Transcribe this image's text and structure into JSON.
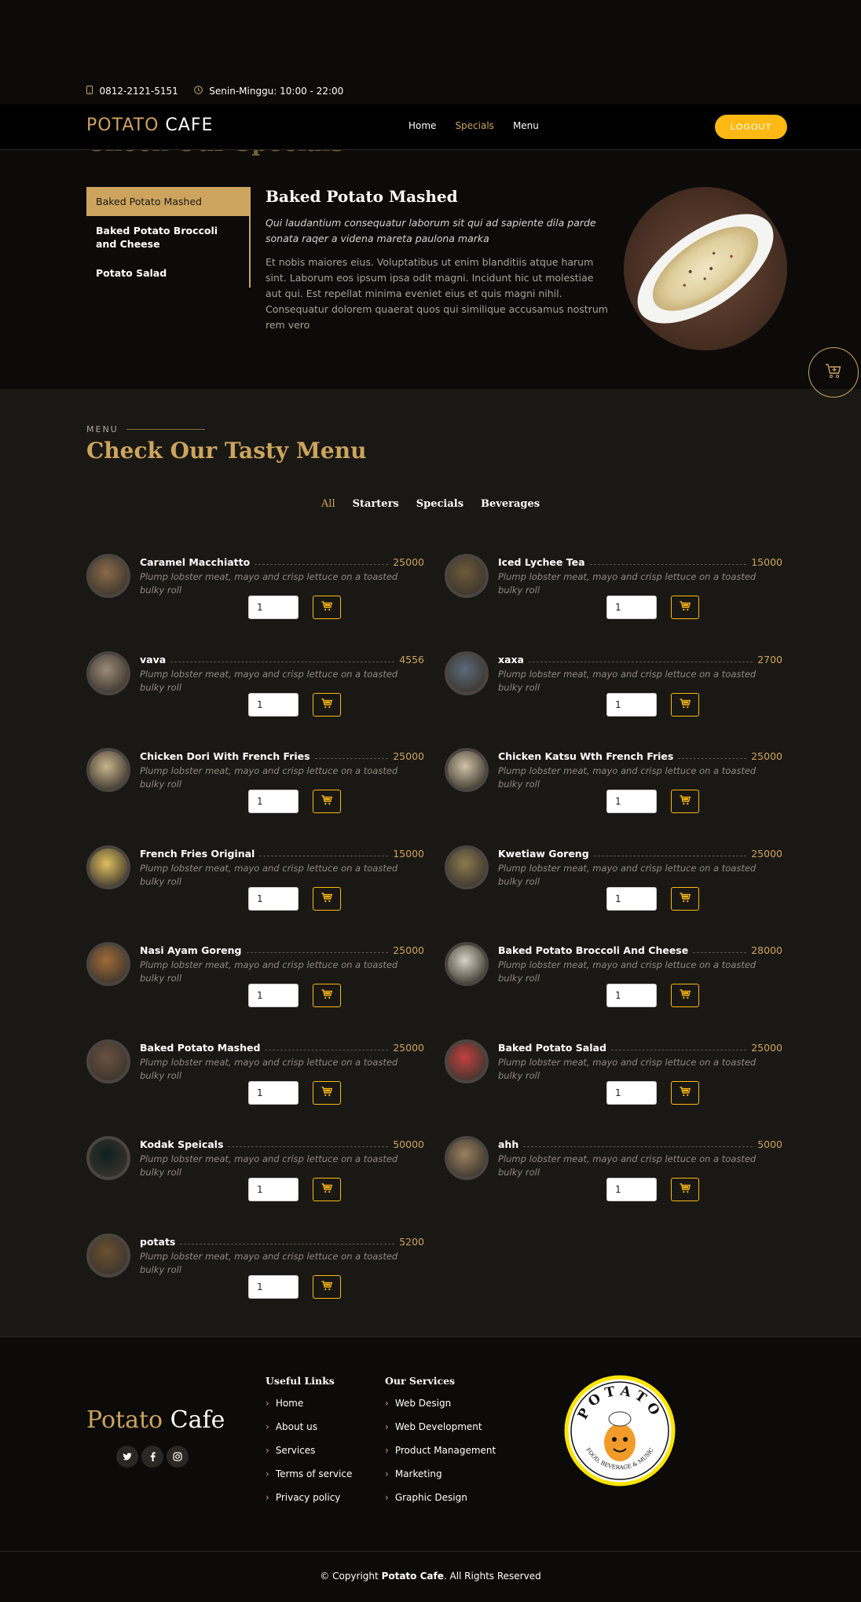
{
  "topbar": {
    "phone": "0812-2121-5151",
    "hours": "Senin-Minggu: 10:00 - 22:00"
  },
  "header": {
    "logo_a": "POTATO",
    "logo_b": "CAFE",
    "nav": [
      "Home",
      "Specials",
      "Menu"
    ],
    "active_nav": "Specials",
    "logout_label": "LOGOUT"
  },
  "specials": {
    "title": "Check Our Specials",
    "tabs": [
      "Baked Potato Mashed",
      "Baked Potato Broccoli and Cheese",
      "Potato Salad"
    ],
    "active_tab": 0,
    "heading": "Baked Potato Mashed",
    "lead": "Qui laudantium consequatur laborum sit qui ad sapiente dila parde sonata raqer a videna mareta paulona marka",
    "description": "Et nobis maiores eius. Voluptatibus ut enim blanditiis atque harum sint. Laborum eos ipsum ipsa odit magni. Incidunt hic ut molestiae aut qui. Est repellat minima eveniet eius et quis magni nihil. Consequatur dolorem quaerat quos qui similique accusamus nostrum rem vero"
  },
  "menu": {
    "eyebrow": "MENU",
    "title": "Check Our Tasty Menu",
    "filters": [
      "All",
      "Starters",
      "Specials",
      "Beverages"
    ],
    "active_filter": "All",
    "ingredients": "Plump lobster meat, mayo and crisp lettuce on a toasted bulky roll",
    "default_qty": "1",
    "items": [
      {
        "name": "Caramel Macchiatto",
        "price": "25000",
        "thumb": "#8a6a4a"
      },
      {
        "name": "Iced Lychee Tea",
        "price": "15000",
        "thumb": "#6b5a3a"
      },
      {
        "name": "vava",
        "price": "4556",
        "thumb": "#9a8a7a"
      },
      {
        "name": "xaxa",
        "price": "2700",
        "thumb": "#5a6a7a"
      },
      {
        "name": "Chicken Dori With French Fries",
        "price": "25000",
        "thumb": "#c9b58a"
      },
      {
        "name": "Chicken Katsu Wth French Fries",
        "price": "25000",
        "thumb": "#d0c4a8"
      },
      {
        "name": "French Fries Original",
        "price": "15000",
        "thumb": "#e0c060"
      },
      {
        "name": "Kwetiaw Goreng",
        "price": "25000",
        "thumb": "#8a7a50"
      },
      {
        "name": "Nasi Ayam Goreng",
        "price": "25000",
        "thumb": "#a06a3a"
      },
      {
        "name": "Baked Potato Broccoli And Cheese",
        "price": "28000",
        "thumb": "#d8d2c4"
      },
      {
        "name": "Baked Potato Mashed",
        "price": "25000",
        "thumb": "#6a5040"
      },
      {
        "name": "Baked Potato Salad",
        "price": "25000",
        "thumb": "#c04040"
      },
      {
        "name": "Kodak Speicals",
        "price": "50000",
        "thumb": "#102020"
      },
      {
        "name": "ahh",
        "price": "5000",
        "thumb": "#9a8060"
      },
      {
        "name": "potats",
        "price": "5200",
        "thumb": "#6a5030"
      }
    ]
  },
  "footer": {
    "brand_a": "Potato",
    "brand_b": "Cafe",
    "social": [
      "twitter-icon",
      "facebook-icon",
      "instagram-icon"
    ],
    "useful_links_title": "Useful Links",
    "useful_links": [
      "Home",
      "About us",
      "Services",
      "Terms of service",
      "Privacy policy"
    ],
    "services_title": "Our Services",
    "services": [
      "Web Design",
      "Web Development",
      "Product Management",
      "Marketing",
      "Graphic Design"
    ],
    "badge_top": "POTATO",
    "badge_bottom": "FOOD, BEVERAGE & MUSIC"
  },
  "copyright": {
    "prefix": "© Copyright",
    "brand": "Potato Cafe",
    "suffix": ". All Rights Reserved"
  },
  "colors": {
    "accent": "#cda45e",
    "logout": "#fdb813",
    "bg_dark": "#0c0b09",
    "bg_menu": "#1a1814"
  }
}
